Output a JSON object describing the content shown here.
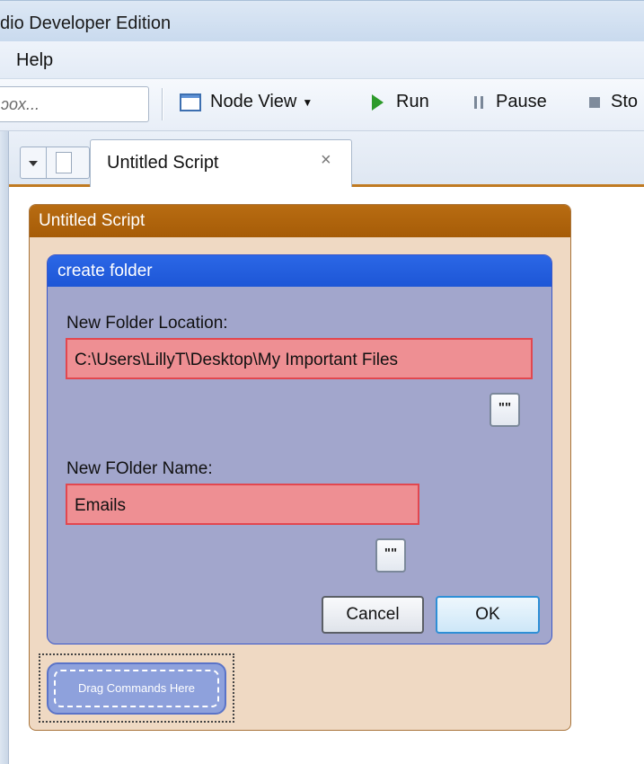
{
  "window": {
    "title": "dio Developer Edition"
  },
  "menubar": {
    "help": "Help"
  },
  "toolbar": {
    "search_placeholder": "ɔox...",
    "node_view_label": "Node View",
    "run_label": "Run",
    "pause_label": "Pause",
    "stop_label": "Sto"
  },
  "tabs": {
    "active_label": "Untitled Script",
    "close_glyph": "×"
  },
  "script": {
    "title": "Untitled Script",
    "command": {
      "title": "create folder",
      "location_label": "New Folder Location:",
      "location_value": "C:\\Users\\LillyT\\Desktop\\My Important Files",
      "name_label": "New FOlder Name:",
      "name_value": "Emails",
      "quote_glyph": "\"\"",
      "cancel_label": "Cancel",
      "ok_label": "OK"
    },
    "drag_hint": "Drag Commands Here"
  },
  "icons": {
    "node_view": "window-icon",
    "run": "play-icon",
    "pause": "pause-icon",
    "stop": "stop-icon",
    "dropdown": "dropdown-arrow-icon",
    "new_tab": "document-icon",
    "close": "close-icon"
  },
  "colors": {
    "script_header": "#a65c07",
    "script_body": "#efd9c3",
    "command_header": "#1d56d6",
    "command_body": "#a2a6cc",
    "input_error_fill": "#ee8f93",
    "input_error_border": "#e2474f",
    "drag_pill": "#8ea1dc"
  }
}
